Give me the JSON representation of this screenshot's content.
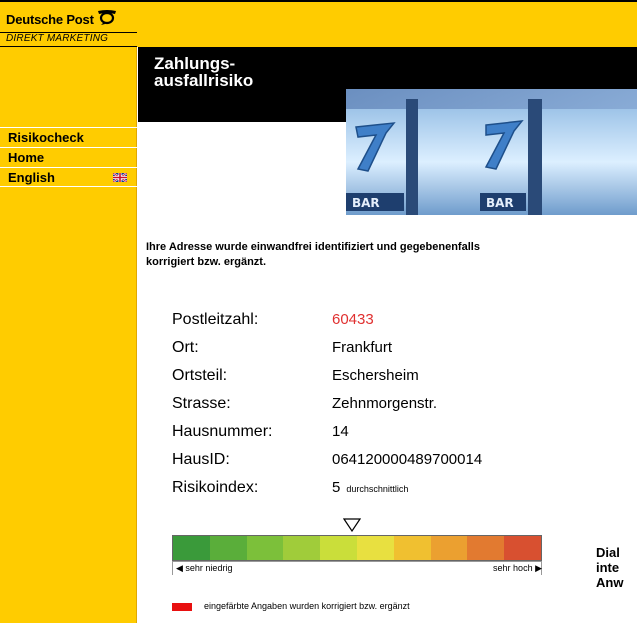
{
  "branding": {
    "logo_text": "Deutsche Post",
    "logo_sub": "DIREKT MARKETING"
  },
  "nav": {
    "items": [
      {
        "label": "Risikocheck"
      },
      {
        "label": "Home"
      },
      {
        "label": "English"
      }
    ]
  },
  "header": {
    "title_line1": "Zahlungs-",
    "title_line2": "ausfallrisiko"
  },
  "intro_text": "Ihre Adresse wurde einwandfrei identifiziert und gegebenenfalls korrigiert bzw. ergänzt.",
  "fields": [
    {
      "label": "Postleitzahl:",
      "value": "60433",
      "corrected": true
    },
    {
      "label": "Ort:",
      "value": "Frankfurt"
    },
    {
      "label": "Ortsteil:",
      "value": "Eschersheim"
    },
    {
      "label": "Strasse:",
      "value": "Zehnmorgenstr."
    },
    {
      "label": "Hausnummer:",
      "value": "14"
    },
    {
      "label": "HausID:",
      "value": "064120000489700014"
    },
    {
      "label": "Risikoindex:",
      "value": "5",
      "note": "durchschnittlich"
    }
  ],
  "scale": {
    "low_label": "◀ sehr niedrig",
    "high_label": "sehr hoch ▶",
    "segments": 10,
    "selected_index": 5,
    "colors": [
      "#3a9a3a",
      "#5aae3a",
      "#7cc03a",
      "#a0cc3a",
      "#cade3a",
      "#e8e040",
      "#f0c030",
      "#eba030",
      "#e27a30",
      "#d85030"
    ]
  },
  "legend": {
    "color": "#e81010",
    "text": "eingefärbte Angaben wurden korrigiert bzw. ergänzt"
  },
  "side_note": {
    "line1": "Dial",
    "line2": "inte",
    "line3": "Anw"
  }
}
